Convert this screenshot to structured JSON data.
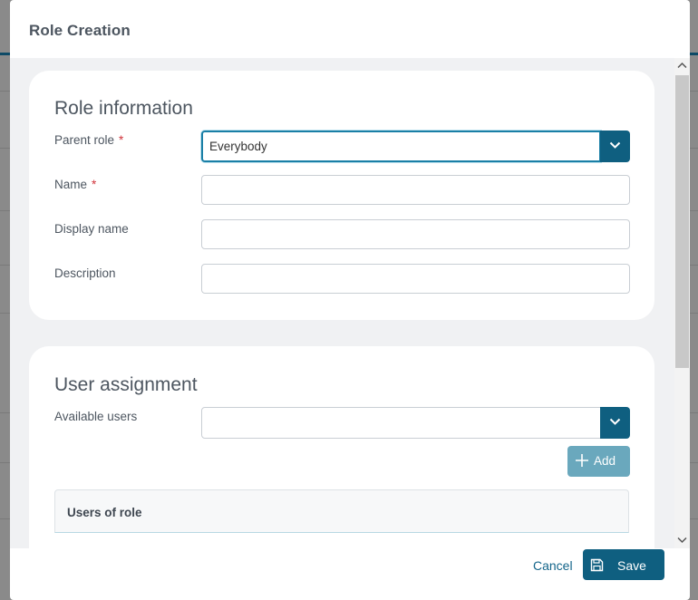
{
  "dialog": {
    "title": "Role Creation"
  },
  "role_information": {
    "heading": "Role information",
    "parent_role": {
      "label": "Parent role",
      "required_mark": "*",
      "value": "Everybody"
    },
    "name": {
      "label": "Name",
      "required_mark": "*",
      "value": ""
    },
    "display_name": {
      "label": "Display name",
      "value": ""
    },
    "description": {
      "label": "Description",
      "value": ""
    }
  },
  "user_assignment": {
    "heading": "User assignment",
    "available_users": {
      "label": "Available users",
      "value": ""
    },
    "add_label": "Add",
    "table": {
      "columns": [
        "Users of role"
      ]
    }
  },
  "footer": {
    "cancel_label": "Cancel",
    "save_label": "Save"
  },
  "colors": {
    "accent": "#0f5f80",
    "add_button": "#6aa8bd",
    "required": "#d1343c",
    "link": "#14658a"
  },
  "icons": [
    "chevron-down-icon",
    "plus-icon",
    "floppy-disk-icon",
    "scroll-up-icon",
    "scroll-down-icon"
  ]
}
